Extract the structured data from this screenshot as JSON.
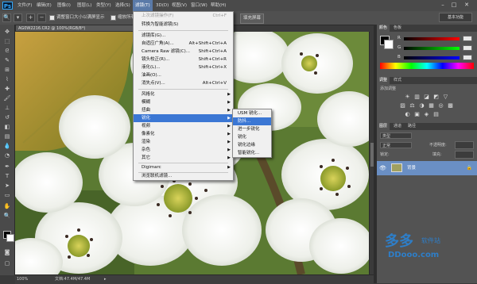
{
  "app": {
    "logo": "Ps"
  },
  "menubar": {
    "items": [
      "文件(F)",
      "编辑(E)",
      "图像(I)",
      "图层(L)",
      "类型(Y)",
      "选择(S)",
      "滤镜(T)",
      "3D(D)",
      "视图(V)",
      "窗口(W)",
      "帮助(H)"
    ],
    "active_index": 6,
    "window_controls": [
      "–",
      "□",
      "✕"
    ]
  },
  "options": {
    "resize_label": "调整窗口大小以满屏显示",
    "zoom_all_label": "缩放所有",
    "fill_screen_button": "填充屏幕",
    "workspace": "基本功能"
  },
  "document": {
    "tab_title": "AG0W2216.CR2 @ 100%(RGB/8*)",
    "zoom": "100%",
    "doc_size": "文档:47.4M/47.4M"
  },
  "filter_menu": {
    "items": [
      {
        "label": "上次滤镜操作(F)",
        "shortcut": "Ctrl+F",
        "disabled": true
      },
      {
        "label": "转换为智能滤镜(S)",
        "shortcut": ""
      },
      {
        "sep": true
      },
      {
        "label": "滤镜库(G)...",
        "shortcut": ""
      },
      {
        "label": "自适应广角(A)...",
        "shortcut": "Alt+Shift+Ctrl+A"
      },
      {
        "label": "Camera Raw 滤镜(C)...",
        "shortcut": "Shift+Ctrl+A"
      },
      {
        "label": "镜头校正(R)...",
        "shortcut": "Shift+Ctrl+R"
      },
      {
        "label": "液化(L)...",
        "shortcut": "Shift+Ctrl+X"
      },
      {
        "label": "油画(O)...",
        "shortcut": ""
      },
      {
        "label": "消失点(V)...",
        "shortcut": "Alt+Ctrl+V"
      },
      {
        "sep": true
      },
      {
        "label": "风格化",
        "submenu": true
      },
      {
        "label": "模糊",
        "submenu": true
      },
      {
        "label": "扭曲",
        "submenu": true
      },
      {
        "label": "锐化",
        "submenu": true,
        "highlight": true
      },
      {
        "label": "视频",
        "submenu": true
      },
      {
        "label": "像素化",
        "submenu": true
      },
      {
        "label": "渲染",
        "submenu": true
      },
      {
        "label": "杂色",
        "submenu": true
      },
      {
        "label": "其它",
        "submenu": true
      },
      {
        "sep": true
      },
      {
        "label": "Digimarc",
        "submenu": true
      },
      {
        "sep": true
      },
      {
        "label": "浏览联机滤镜...",
        "shortcut": ""
      }
    ]
  },
  "sharpen_submenu": {
    "items": [
      {
        "label": "USM 锐化..."
      },
      {
        "label": "防抖...",
        "highlight": true
      },
      {
        "label": "进一步锐化"
      },
      {
        "label": "锐化"
      },
      {
        "label": "锐化边缘"
      },
      {
        "label": "智能锐化..."
      }
    ]
  },
  "color_panel": {
    "tabs": [
      "颜色",
      "色板"
    ],
    "sliders": [
      {
        "label": "R",
        "value": "0",
        "color": "#d43c3c"
      },
      {
        "label": "G",
        "value": "0",
        "color": "#3cb43c"
      },
      {
        "label": "B",
        "value": "0",
        "color": "#3c5cd4"
      }
    ]
  },
  "adjustments_panel": {
    "tabs": [
      "调整",
      "样式"
    ],
    "title": "添加调整",
    "row1": [
      "☀",
      "▥",
      "◪",
      "◩",
      "▽"
    ],
    "row2": [
      "▨",
      "⚖",
      "◑",
      "▦",
      "◎",
      "▩"
    ],
    "row3": [
      "◐",
      "▣",
      "◈",
      "▤"
    ]
  },
  "layers_panel": {
    "tabs": [
      "图层",
      "通道",
      "路径"
    ],
    "kind": "类型",
    "mode": "正常",
    "opacity_label": "不透明度:",
    "lock_label": "锁定:",
    "fill_label": "填充:",
    "layer_name": "背景"
  },
  "watermark": {
    "text": "多多",
    "site": "软件站",
    "domain": "DDooo.com"
  }
}
